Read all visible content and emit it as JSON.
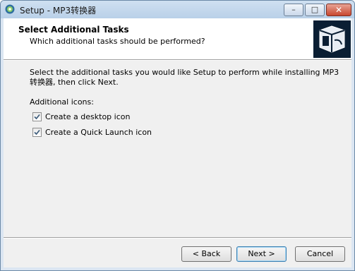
{
  "window": {
    "title": "Setup - MP3转换器"
  },
  "title_controls": {
    "minimize": "–",
    "maximize": "□",
    "close": "✕"
  },
  "header": {
    "title": "Select Additional Tasks",
    "subtitle": "Which additional tasks should be performed?",
    "logo_icon": "installer-box-icon"
  },
  "body": {
    "description": "Select the additional tasks you would like Setup to perform while installing MP3转换器, then click Next.",
    "group_label": "Additional icons:",
    "options": [
      {
        "label": "Create a desktop icon",
        "checked": true
      },
      {
        "label": "Create a Quick Launch icon",
        "checked": true
      }
    ]
  },
  "footer": {
    "back": "< Back",
    "next": "Next >",
    "cancel": "Cancel"
  },
  "colors": {
    "title_bar": "#b9d0e8",
    "logo_bg": "#0a1e33",
    "close_button": "#c8472f"
  }
}
